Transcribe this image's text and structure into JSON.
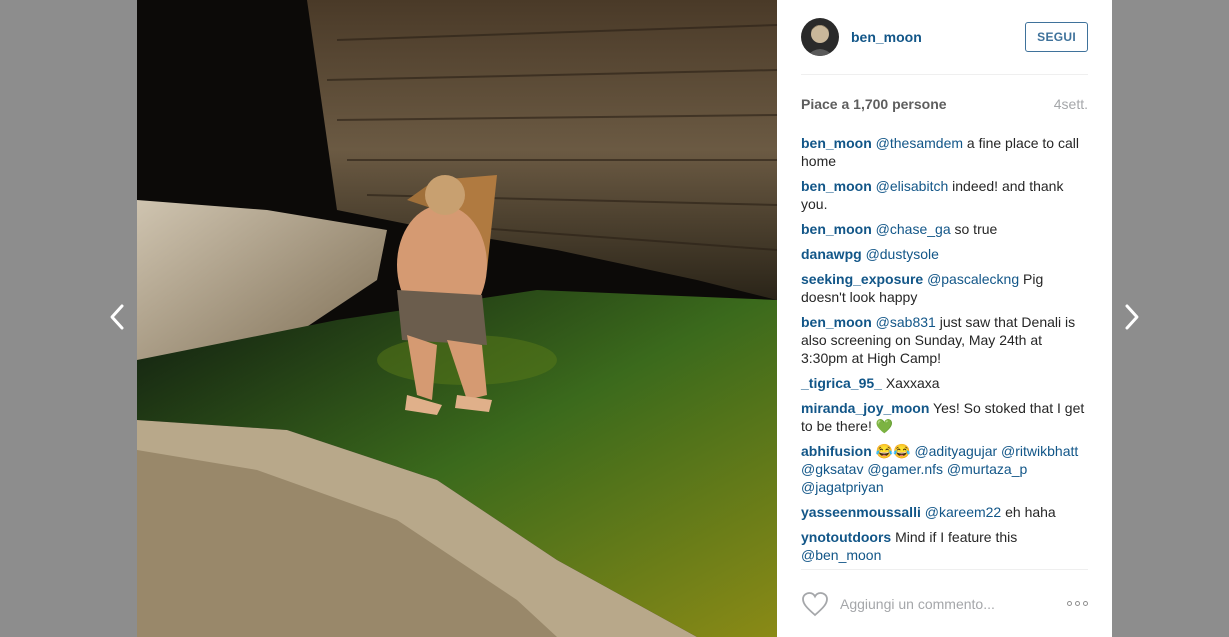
{
  "post": {
    "username": "ben_moon",
    "follow_label": "SEGUI",
    "likes": "Piace a 1,700 persone",
    "time": "4sett."
  },
  "comments": [
    {
      "user": "ben_moon",
      "mention": "@thesamdem",
      "text": " a fine place to call home"
    },
    {
      "user": "ben_moon",
      "mention": "@elisabitch",
      "text": " indeed! and thank you."
    },
    {
      "user": "ben_moon",
      "mention": "@chase_ga",
      "text": " so true"
    },
    {
      "user": "danawpg",
      "mention": "@dustysole",
      "text": ""
    },
    {
      "user": "seeking_exposure",
      "mention": "@pascaleckng",
      "text": " Pig doesn't look happy"
    },
    {
      "user": "ben_moon",
      "mention": "@sab831",
      "text": " just saw that Denali is also screening on Sunday, May 24th at 3:30pm at High Camp!"
    },
    {
      "user": "_tigrica_95_",
      "mention": "",
      "text": " Xaxxaxa"
    },
    {
      "user": "miranda_joy_moon",
      "mention": "",
      "text": " Yes! So stoked that I get to be there! 💚"
    },
    {
      "user": "abhifusion",
      "pre": " 😂😂 ",
      "mention": "@adityagujar @ritwikbhatt @gksatav @gamer.nfs @murtaza_p @jagatpriyan",
      "text": ""
    },
    {
      "user": "yasseenmoussalli",
      "mention": "@kareem22",
      "text": " eh haha"
    },
    {
      "user": "ynotoutdoors",
      "mention": "@ben_moon",
      "pre_text": " Mind if I feature this ",
      "text": ""
    }
  ],
  "footer": {
    "placeholder": "Aggiungi un commento...",
    "icons": [
      "heart-icon",
      "more-options-icon"
    ]
  },
  "nav": {
    "icons": [
      "chevron-left-icon",
      "chevron-right-icon"
    ]
  }
}
